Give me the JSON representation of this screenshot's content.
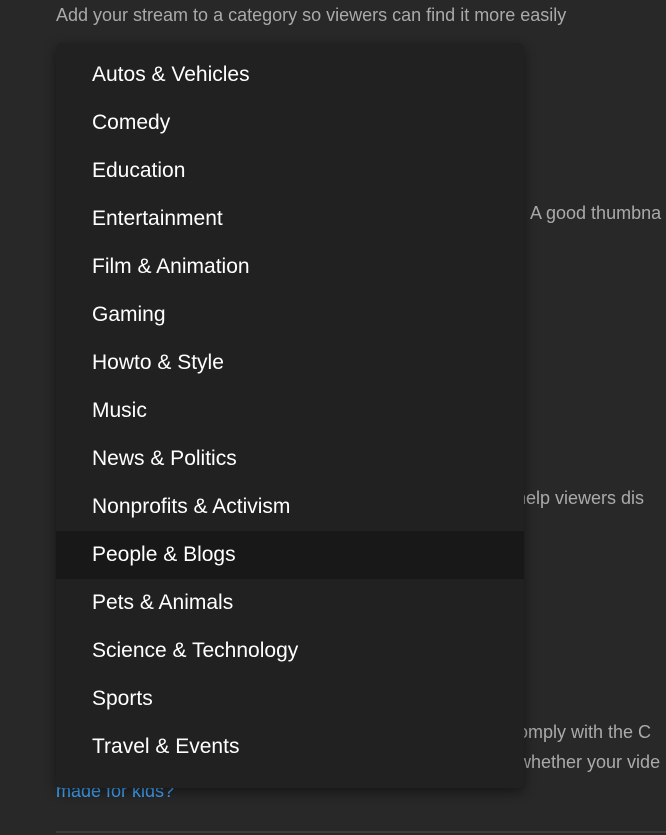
{
  "category_section": {
    "helper_text": "Add your stream to a category so viewers can find it more easily"
  },
  "background_fragments": {
    "thumbnail": "A good thumbna",
    "tags": "help viewers dis",
    "comply": "omply with the C",
    "whether": "whether your vide"
  },
  "audience": {
    "link_text": "made for kids?"
  },
  "dropdown": {
    "selected_index": 10,
    "options": [
      "Autos & Vehicles",
      "Comedy",
      "Education",
      "Entertainment",
      "Film & Animation",
      "Gaming",
      "Howto & Style",
      "Music",
      "News & Politics",
      "Nonprofits & Activism",
      "People & Blogs",
      "Pets & Animals",
      "Science & Technology",
      "Sports",
      "Travel & Events"
    ]
  },
  "colors": {
    "page_bg": "#282828",
    "menu_bg": "#212121",
    "highlight_bg": "#181818",
    "link": "#3ea6ff",
    "muted_text": "#aaaaaa"
  }
}
